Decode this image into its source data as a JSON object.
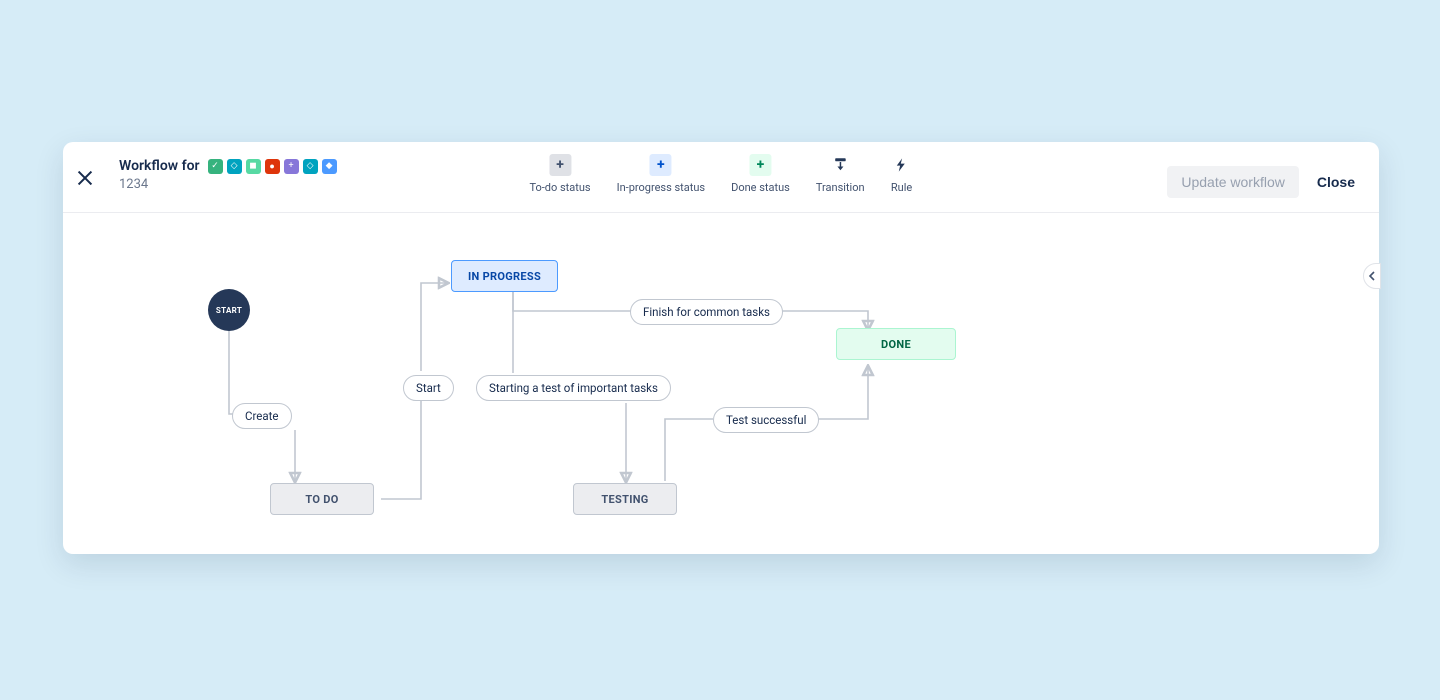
{
  "header": {
    "title_prefix": "Workflow for",
    "subtitle": "1234",
    "project_badges": [
      {
        "bg": "#36b37e",
        "glyph": "✓"
      },
      {
        "bg": "#00a3bf",
        "glyph": "◇"
      },
      {
        "bg": "#57d9a3",
        "glyph": "◼"
      },
      {
        "bg": "#de350b",
        "glyph": "●"
      },
      {
        "bg": "#8777d9",
        "glyph": "+"
      },
      {
        "bg": "#00a3bf",
        "glyph": "◇"
      },
      {
        "bg": "#4c9aff",
        "glyph": "◆"
      }
    ]
  },
  "toolbar": {
    "todo": {
      "label": "To-do status",
      "icon": "+",
      "bg": "#dfe1e6",
      "fg": "#42526e"
    },
    "inprogress": {
      "label": "In-progress status",
      "icon": "+",
      "bg": "#deebff",
      "fg": "#0052cc"
    },
    "done": {
      "label": "Done status",
      "icon": "+",
      "bg": "#e3fcef",
      "fg": "#00875a"
    },
    "transition": {
      "label": "Transition"
    },
    "rule": {
      "label": "Rule"
    }
  },
  "actions": {
    "update": "Update workflow",
    "close": "Close"
  },
  "workflow": {
    "start_label": "START",
    "statuses": {
      "todo": {
        "label": "TO DO"
      },
      "inprogress": {
        "label": "IN PROGRESS"
      },
      "testing": {
        "label": "TESTING"
      },
      "done": {
        "label": "DONE"
      }
    },
    "transitions": {
      "create": {
        "label": "Create"
      },
      "start": {
        "label": "Start"
      },
      "finish_common": {
        "label": "Finish for common tasks"
      },
      "start_test": {
        "label": "Starting a test of important tasks"
      },
      "test_success": {
        "label": "Test successful"
      }
    }
  }
}
